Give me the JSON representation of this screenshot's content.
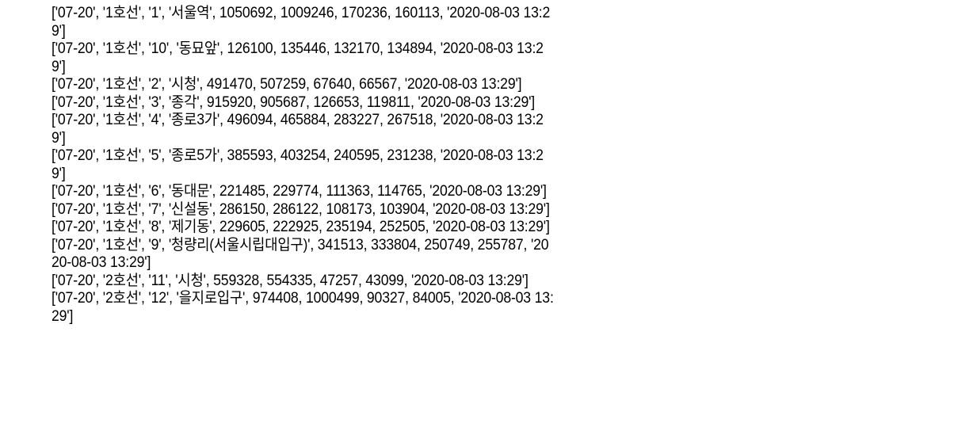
{
  "output_lines": [
    "['07-20', '1호선', '1', '서울역', 1050692, 1009246, 170236, 160113, '2020-08-03 13:2",
    "9']",
    "['07-20', '1호선', '10', '동묘앞', 126100, 135446, 132170, 134894, '2020-08-03 13:2",
    "9']",
    "['07-20', '1호선', '2', '시청', 491470, 507259, 67640, 66567, '2020-08-03 13:29']",
    "['07-20', '1호선', '3', '종각', 915920, 905687, 126653, 119811, '2020-08-03 13:29']",
    "['07-20', '1호선', '4', '종로3가', 496094, 465884, 283227, 267518, '2020-08-03 13:2",
    "9']",
    "['07-20', '1호선', '5', '종로5가', 385593, 403254, 240595, 231238, '2020-08-03 13:2",
    "9']",
    "['07-20', '1호선', '6', '동대문', 221485, 229774, 111363, 114765, '2020-08-03 13:29']",
    "['07-20', '1호선', '7', '신설동', 286150, 286122, 108173, 103904, '2020-08-03 13:29']",
    "['07-20', '1호선', '8', '제기동', 229605, 222925, 235194, 252505, '2020-08-03 13:29']",
    "['07-20', '1호선', '9', '청량리(서울시립대입구)', 341513, 333804, 250749, 255787, '20",
    "20-08-03 13:29']",
    "['07-20', '2호선', '11', '시청', 559328, 554335, 47257, 43099, '2020-08-03 13:29']",
    "['07-20', '2호선', '12', '을지로입구', 974408, 1000499, 90327, 84005, '2020-08-03 13:",
    "29']"
  ]
}
